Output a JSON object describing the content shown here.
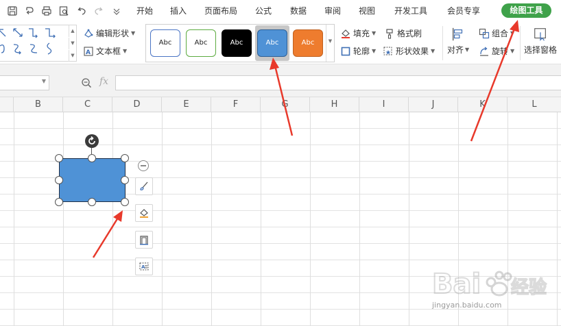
{
  "menu": {
    "tabs": [
      "开始",
      "插入",
      "页面布局",
      "公式",
      "数据",
      "审阅",
      "视图",
      "开发工具",
      "会员专享"
    ],
    "active_contextual_tab": "绘图工具"
  },
  "ribbon": {
    "edit_shape": "编辑形状",
    "text_box": "文本框",
    "style_swatches": [
      {
        "label": "Abc",
        "fill": "#ffffff",
        "border": "#4a74c4",
        "text": "#222222"
      },
      {
        "label": "Abc",
        "fill": "#ffffff",
        "border": "#5cab3f",
        "text": "#222222"
      },
      {
        "label": "Abc",
        "fill": "#000000",
        "border": "#000000",
        "text": "#ffffff"
      },
      {
        "label": "Abc",
        "fill": "#4f92d6",
        "border": "#2e5f95",
        "text": "#ffffff"
      },
      {
        "label": "Abc",
        "fill": "#ee7c2e",
        "border": "#c0611f",
        "text": "#ffffff"
      }
    ],
    "fill": "填充",
    "format_painter": "格式刷",
    "outline": "轮廓",
    "shape_effects": "形状效果",
    "align": "对齐",
    "group": "组合",
    "rotate": "旋转",
    "selection_pane": "选择窗格"
  },
  "formula_bar": {
    "fx_label": "fx",
    "value": ""
  },
  "columns": [
    "B",
    "C",
    "D",
    "E",
    "F",
    "G",
    "H",
    "I",
    "J",
    "K",
    "L"
  ],
  "colors": {
    "accent_green": "#3fa24a",
    "shape_fill": "#4f92d6",
    "annotation_red": "#e8392b"
  },
  "watermark": {
    "brand": "Bai 经验",
    "url": "jingyan.baidu.com"
  }
}
